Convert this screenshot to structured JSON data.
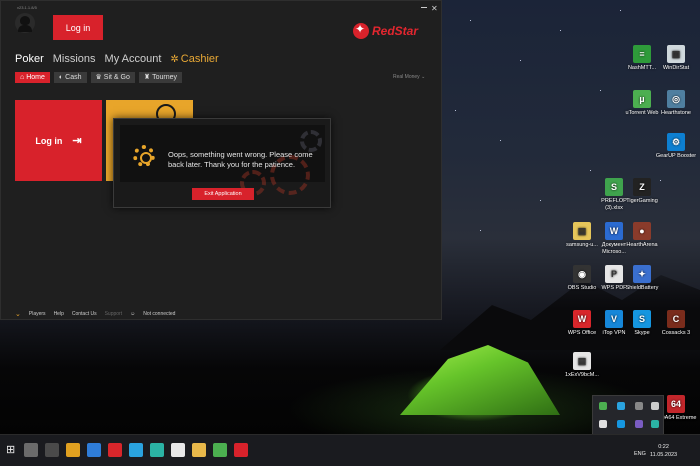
{
  "client": {
    "version": "v23.1.1.8/5",
    "login_button": "Log in",
    "brand": "RedStar",
    "nav": [
      "Poker",
      "Missions",
      "My Account",
      "Cashier"
    ],
    "subnav": [
      "Home",
      "Cash",
      "Sit & Go",
      "Tourney"
    ],
    "money_mode": "Real Money",
    "login_tile": "Log in",
    "footer": {
      "players": "Players",
      "help": "Help",
      "contact": "Contact Us",
      "support": "Support",
      "status": "Not connected"
    }
  },
  "dialog": {
    "message": "Oops, something went wrong. Please come back later. Thank you for the patience.",
    "button": "Exit Application"
  },
  "desktop_icons": [
    {
      "label": "NashMTT...",
      "color": "#2e9b3a",
      "glyph": "≡"
    },
    {
      "label": "WinDirStat",
      "color": "#cfd8dc",
      "glyph": "▦"
    },
    {
      "label": "uTorrent Web",
      "color": "#4caf50",
      "glyph": "µ"
    },
    {
      "label": "Hearthstone",
      "color": "#4f7fa0",
      "glyph": "◎"
    },
    {
      "label": "GearUP Booster",
      "color": "#0d7fd1",
      "glyph": "⚙"
    },
    {
      "label": "PREFLOP (3).xlsx",
      "color": "#3fa34d",
      "glyph": "S"
    },
    {
      "label": "TigerGaming",
      "color": "#222",
      "glyph": "Z"
    },
    {
      "label": "samsung-u...",
      "color": "#e6c65a",
      "glyph": "▤"
    },
    {
      "label": "Документ Microso...",
      "color": "#2b6bd1",
      "glyph": "W"
    },
    {
      "label": "HearthArena",
      "color": "#8a3b2b",
      "glyph": "●"
    },
    {
      "label": "OBS Studio",
      "color": "#333",
      "glyph": "◉"
    },
    {
      "label": "WPS PDF",
      "color": "#e6e6e6",
      "glyph": "P"
    },
    {
      "label": "ShieldBattery",
      "color": "#3a6fcf",
      "glyph": "✦"
    },
    {
      "label": "WPS Office",
      "color": "#d8262b",
      "glyph": "W"
    },
    {
      "label": "iTop VPN",
      "color": "#1687d9",
      "glyph": "V"
    },
    {
      "label": "Skype",
      "color": "#1596e0",
      "glyph": "S"
    },
    {
      "label": "Cossacks 3",
      "color": "#7a2c1c",
      "glyph": "C"
    },
    {
      "label": "1xExV9bcM...",
      "color": "#e6e6e6",
      "glyph": "▤"
    },
    {
      "label": "AIDA64 Extreme",
      "color": "#c2262b",
      "glyph": "64"
    }
  ],
  "taskbar": {
    "language": "ENG",
    "time": "0:22",
    "date": "11.05.2023",
    "pinned": [
      {
        "name": "search",
        "color": "#6b6b6b"
      },
      {
        "name": "task-view",
        "color": "#4a4a4a"
      },
      {
        "name": "calculator",
        "color": "#e0a020"
      },
      {
        "name": "mail",
        "color": "#2f7dd8"
      },
      {
        "name": "wps",
        "color": "#d8262b"
      },
      {
        "name": "telegram",
        "color": "#2aa3df"
      },
      {
        "name": "edge",
        "color": "#2bb3a5"
      },
      {
        "name": "yandex",
        "color": "#e8e8e8"
      },
      {
        "name": "folder",
        "color": "#e8b84a"
      },
      {
        "name": "app-green",
        "color": "#4caf50"
      },
      {
        "name": "redstar",
        "color": "#d8222b"
      }
    ]
  }
}
